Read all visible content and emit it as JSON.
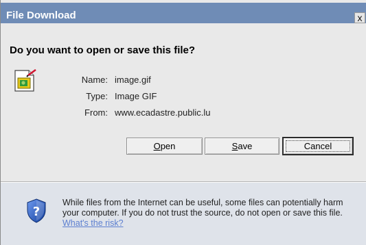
{
  "window": {
    "title": "File Download",
    "close_glyph": "x"
  },
  "prompt": {
    "heading": "Do you want to open or save this file?"
  },
  "file": {
    "icon": "gif-image-file-icon",
    "name_label": "Name:",
    "name": "image.gif",
    "type_label": "Type:",
    "type": "Image GIF",
    "from_label": "From:",
    "from": "www.ecadastre.public.lu"
  },
  "buttons": {
    "open": {
      "accel": "O",
      "rest": "pen"
    },
    "save": {
      "accel": "S",
      "rest": "ave"
    },
    "cancel": "Cancel"
  },
  "footer": {
    "icon": "security-shield-question-icon",
    "warning": "While files from the Internet can be useful, some files can potentially harm your computer. If you do not trust the source, do not open or save this file.",
    "risk_link": "What's the risk?"
  },
  "colors": {
    "titlebar": "#6f8cb6",
    "dialog_bg": "#e9e9e9",
    "footer_bg": "#dfe3ea",
    "link": "#5c7fd0"
  }
}
